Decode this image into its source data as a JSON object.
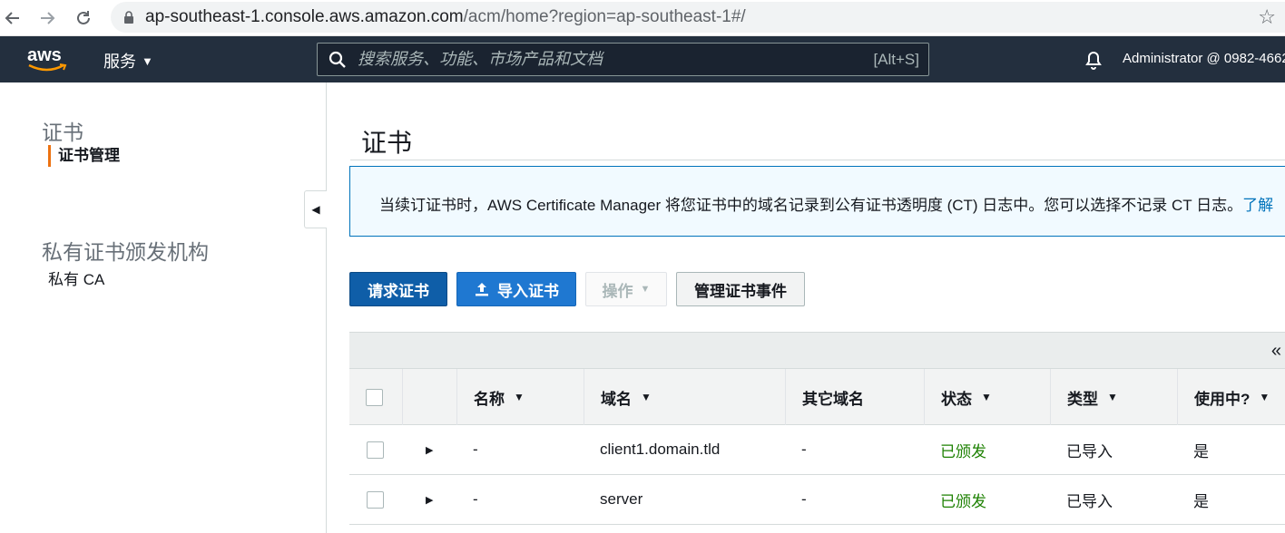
{
  "browser": {
    "url_domain": "ap-southeast-1.console.aws.amazon.com",
    "url_path": "/acm/home?region=ap-southeast-1#/"
  },
  "header": {
    "logo": "aws",
    "services_label": "服务",
    "search_placeholder": "搜索服务、功能、市场产品和文档",
    "search_shortcut": "[Alt+S]",
    "account": "Administrator @ 0982-4662"
  },
  "sidebar": {
    "section1_title": "证书",
    "section1_item": "证书管理",
    "section2_title": "私有证书颁发机构",
    "section2_item": "私有 CA"
  },
  "main": {
    "page_title": "证书",
    "banner_text": "当续订证书时，AWS Certificate Manager 将您证书中的域名记录到公有证书透明度 (CT) 日志中。您可以选择不记录 CT 日志。",
    "banner_link": "了解",
    "buttons": {
      "request": "请求证书",
      "import": "导入证书",
      "actions": "操作",
      "manage_events": "管理证书事件"
    },
    "table": {
      "columns": [
        "名称",
        "域名",
        "其它域名",
        "状态",
        "类型",
        "使用中?"
      ],
      "rows": [
        {
          "name": "-",
          "domain": "client1.domain.tld",
          "other": "-",
          "status": "已颁发",
          "type": "已导入",
          "in_use": "是"
        },
        {
          "name": "-",
          "domain": "server",
          "other": "-",
          "status": "已颁发",
          "type": "已导入",
          "in_use": "是"
        }
      ]
    }
  },
  "colors": {
    "header_bg": "#232f3e",
    "accent_orange": "#ec7211",
    "link_blue": "#0073bb",
    "status_green": "#1d8102"
  }
}
